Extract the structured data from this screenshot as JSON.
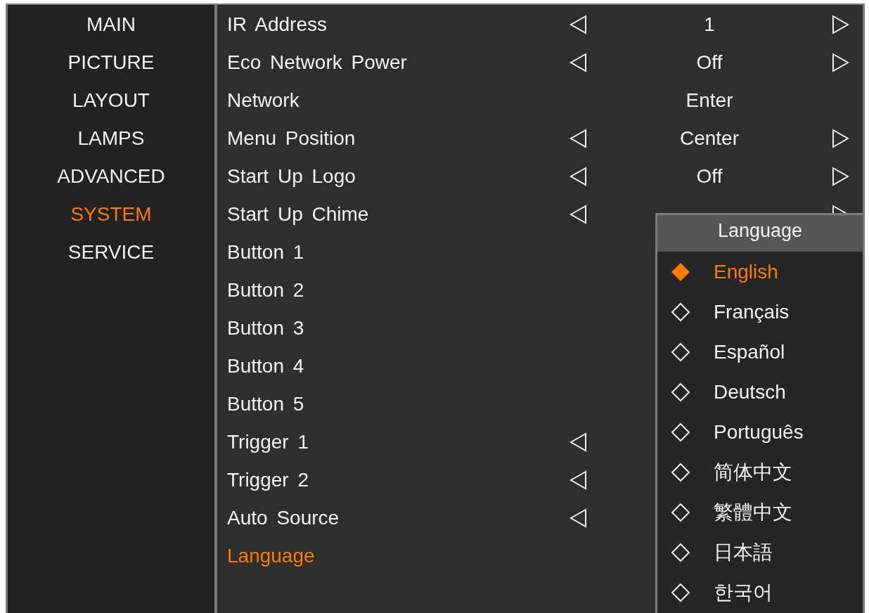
{
  "sidebar": {
    "items": [
      {
        "label": "MAIN",
        "selected": false
      },
      {
        "label": "PICTURE",
        "selected": false
      },
      {
        "label": "LAYOUT",
        "selected": false
      },
      {
        "label": "LAMPS",
        "selected": false
      },
      {
        "label": "ADVANCED",
        "selected": false
      },
      {
        "label": "SYSTEM",
        "selected": true
      },
      {
        "label": "SERVICE",
        "selected": false
      }
    ]
  },
  "menu": {
    "items": [
      {
        "label": "IR Address",
        "kind": "option",
        "value": "1",
        "selected": false
      },
      {
        "label": "Eco Network Power",
        "kind": "option",
        "value": "Off",
        "selected": false
      },
      {
        "label": "Network",
        "kind": "action",
        "value": "Enter",
        "selected": false
      },
      {
        "label": "Menu Position",
        "kind": "option",
        "value": "Center",
        "selected": false
      },
      {
        "label": "Start Up Logo",
        "kind": "option",
        "value": "Off",
        "selected": false
      },
      {
        "label": "Start Up Chime",
        "kind": "option",
        "right_arrow": true,
        "selected": false
      },
      {
        "label": "Button 1",
        "kind": "plain",
        "selected": false
      },
      {
        "label": "Button 2",
        "kind": "plain",
        "selected": false
      },
      {
        "label": "Button 3",
        "kind": "plain",
        "selected": false
      },
      {
        "label": "Button 4",
        "kind": "plain",
        "selected": false
      },
      {
        "label": "Button 5",
        "kind": "plain",
        "selected": false
      },
      {
        "label": "Trigger 1",
        "kind": "option",
        "selected": false
      },
      {
        "label": "Trigger 2",
        "kind": "option",
        "selected": false
      },
      {
        "label": "Auto Source",
        "kind": "option",
        "selected": false
      },
      {
        "label": "Language",
        "kind": "plain",
        "selected": true
      }
    ]
  },
  "language_popup": {
    "title": "Language",
    "options": [
      {
        "label": "English",
        "selected": true
      },
      {
        "label": "Français",
        "selected": false
      },
      {
        "label": "Español",
        "selected": false
      },
      {
        "label": "Deutsch",
        "selected": false
      },
      {
        "label": "Português",
        "selected": false
      },
      {
        "label": "简体中文",
        "selected": false
      },
      {
        "label": "繁體中文",
        "selected": false
      },
      {
        "label": "日本語",
        "selected": false
      },
      {
        "label": "한국어",
        "selected": false
      }
    ]
  }
}
